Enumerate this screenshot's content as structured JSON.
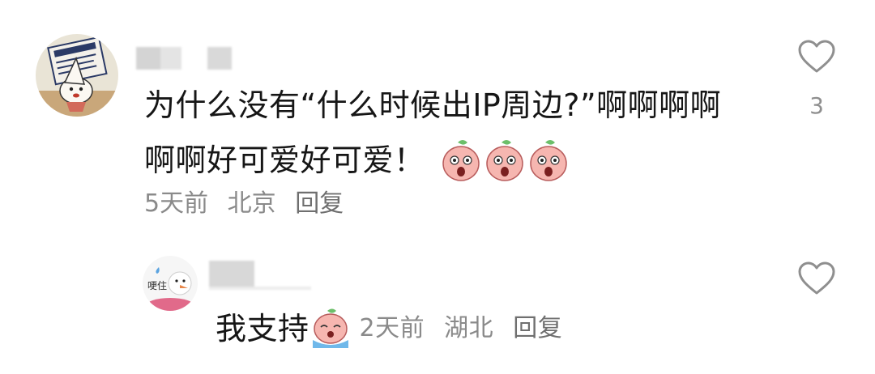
{
  "comment": {
    "text_line1": "为什么没有“什么时候出IP周边?”啊啊啊啊",
    "text_line2": "啊啊好可爱好可爱！",
    "meta": {
      "time": "5天前",
      "location": "北京",
      "reply_label": "回复"
    },
    "like_count": "3",
    "stickers": [
      "peach-shocked-sticker",
      "peach-shocked-sticker",
      "peach-shocked-sticker"
    ]
  },
  "reply": {
    "avatar_text": "哽住",
    "text": "我支持",
    "sticker": "peach-crying-sticker",
    "meta": {
      "time": "2天前",
      "location": "湖北",
      "reply_label": "回复"
    }
  },
  "colors": {
    "text": "#161616",
    "meta": "#8a8a8a",
    "icon": "#8f8f8f",
    "blur": "#d0d0d0"
  }
}
